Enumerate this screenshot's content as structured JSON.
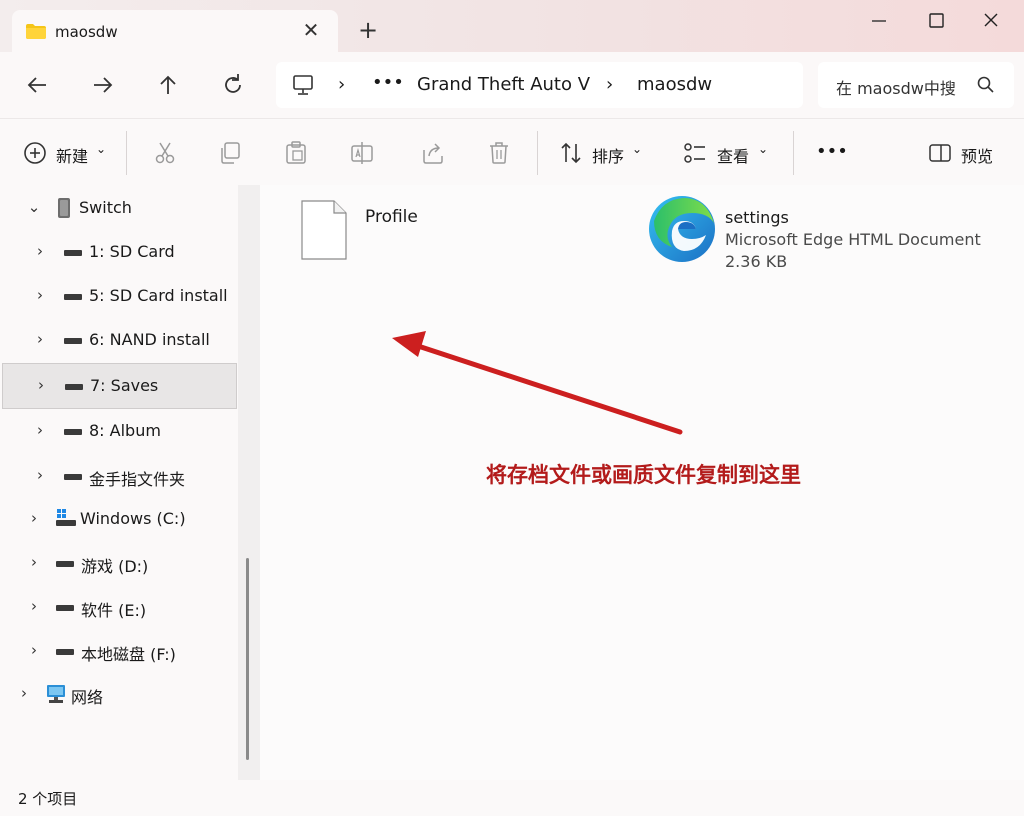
{
  "tab": {
    "title": "maosdw",
    "close_icon": "close-icon",
    "new_tab_icon": "plus-icon"
  },
  "window": {
    "minimize": "minimize-icon",
    "maximize": "maximize-icon",
    "close": "close-icon"
  },
  "nav": {
    "back": "arrow-left-icon",
    "forward": "arrow-right-icon",
    "up": "arrow-up-icon",
    "refresh": "refresh-icon"
  },
  "address": {
    "crumbs": [
      "Grand Theft Auto V",
      "maosdw"
    ],
    "overflow": "•••"
  },
  "search": {
    "placeholder": "在 maosdw中搜"
  },
  "toolbar": {
    "new_label": "新建",
    "sort_label": "排序",
    "view_label": "查看",
    "more_label": "•••",
    "preview_label": "预览"
  },
  "sidebar": {
    "items": [
      {
        "label": "Switch",
        "expanded": true
      },
      {
        "label": "1: SD Card"
      },
      {
        "label": "5: SD Card install"
      },
      {
        "label": "6: NAND install"
      },
      {
        "label": "7: Saves",
        "selected": true
      },
      {
        "label": "8: Album"
      },
      {
        "label": "金手指文件夹"
      },
      {
        "label": "Windows (C:)"
      },
      {
        "label": "游戏 (D:)"
      },
      {
        "label": "软件 (E:)"
      },
      {
        "label": "本地磁盘 (F:)"
      },
      {
        "label": "网络"
      }
    ]
  },
  "files": [
    {
      "name": "Profile",
      "icon": "blank-file-icon"
    },
    {
      "name": "settings",
      "type": "Microsoft Edge HTML Document",
      "size": "2.36 KB",
      "icon": "edge-icon"
    }
  ],
  "annotation": {
    "text": "将存档文件或画质文件复制到这里",
    "color": "#b31b1b"
  },
  "status": {
    "count": "2 个项目"
  }
}
